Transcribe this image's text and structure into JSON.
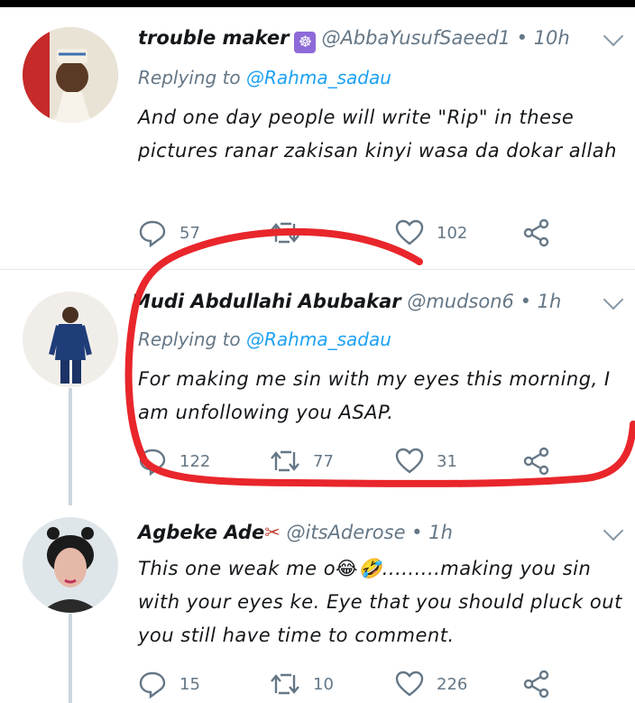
{
  "tweets": [
    {
      "name": "trouble maker",
      "badge_icon": "ship-wheel-emoji",
      "handle": "@AbbaYusufSaeed1",
      "time": "10h",
      "replying_prefix": "Replying to",
      "replying_handle": "@Rahma_sadau",
      "text": "And one day people will write \"Rip\" in these pictures ranar zakisan kinyi wasa da dokar allah",
      "counts": {
        "replies": "57",
        "retweets": "",
        "likes": "102"
      }
    },
    {
      "name": "Mudi Abdullahi Abubakar",
      "handle": "@mudson6",
      "time": "1h",
      "replying_prefix": "Replying to",
      "replying_handle": "@Rahma_sadau",
      "text": "For making me sin with my eyes this morning, I am unfollowing you ASAP.",
      "counts": {
        "replies": "122",
        "retweets": "77",
        "likes": "31"
      }
    },
    {
      "name": "Agbeke Ade",
      "name_emoji": "scissors-emoji",
      "handle": "@itsAderose",
      "time": "1h",
      "text": "This one weak me o😂🤣.........making you sin with your eyes ke. Eye that you should pluck out you still have time to comment.",
      "counts": {
        "replies": "15",
        "retweets": "10",
        "likes": "226"
      }
    }
  ],
  "separator": "•",
  "colors": {
    "accent": "#1da1f2",
    "muted": "#657786",
    "annotation": "#e8262b"
  }
}
